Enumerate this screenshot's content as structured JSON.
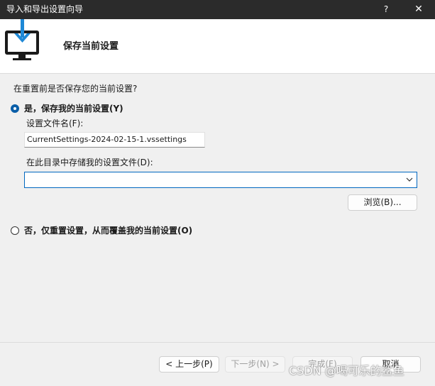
{
  "titlebar": {
    "title": "导入和导出设置向导",
    "help_label": "?",
    "close_label": "✕"
  },
  "header": {
    "title": "保存当前设置",
    "icon": "monitor-download-icon"
  },
  "content": {
    "question": "在重置前是否保存您的当前设置?",
    "option_save": {
      "label": "是，保存我的当前设置(Y)",
      "checked": true
    },
    "filename_label": "设置文件名(F):",
    "filename_value": "CurrentSettings-2024-02-15-1.vssettings",
    "directory_label": "在此目录中存储我的设置文件(D):",
    "directory_value": "",
    "browse_label": "浏览(B)...",
    "option_reset": {
      "label": "否，仅重置设置，从而覆盖我的当前设置(O)",
      "checked": false
    }
  },
  "footer": {
    "back_label": "< 上一步(P)",
    "next_label": "下一步(N) >",
    "finish_label": "完成(F)",
    "cancel_label": "取消"
  },
  "watermark": "CSDN @喝可乐的鲨鱼",
  "colors": {
    "titlebar_bg": "#2b2b2b",
    "accent": "#0067c0",
    "icon_blue": "#1e88d6"
  }
}
